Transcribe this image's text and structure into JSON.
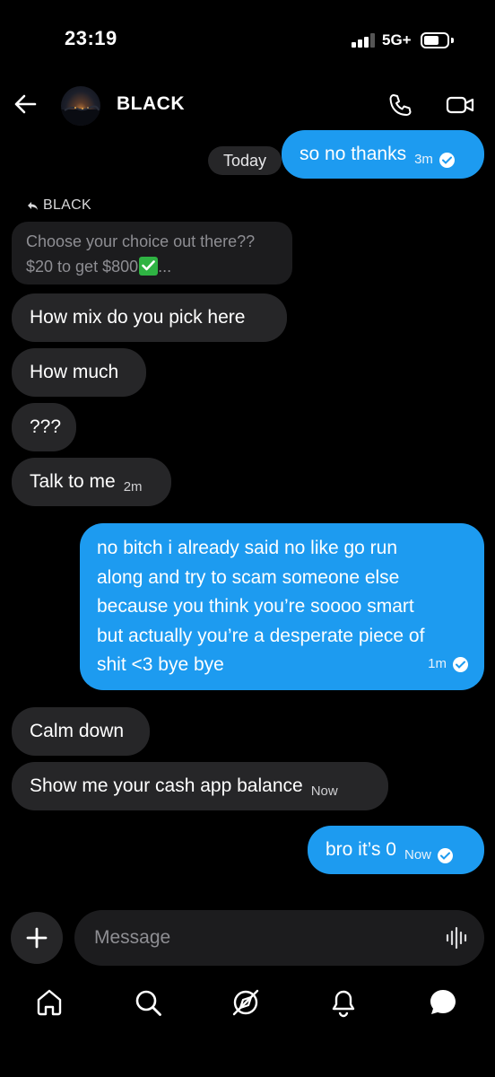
{
  "status_bar": {
    "time": "23:19",
    "network": "5G+",
    "battery_level": 0.65
  },
  "header": {
    "contact_name": "BLACK",
    "back_icon": "arrow-left-icon",
    "call_icon": "phone-icon",
    "video_icon": "video-camera-icon"
  },
  "thread": {
    "date_label": "Today",
    "messages": [
      {
        "from": "me",
        "text": "so no thanks",
        "time": "3m",
        "read": true
      },
      {
        "from": "them",
        "reply_to_name": "BLACK",
        "quoted_line_1": "Choose your choice out there??",
        "quoted_line_2": "$20 to get $800",
        "quoted_suffix": "..."
      },
      {
        "from": "them",
        "text": "How mix do you pick here"
      },
      {
        "from": "them",
        "text": "How much"
      },
      {
        "from": "them",
        "text": "???"
      },
      {
        "from": "them",
        "text": "Talk to me",
        "time": "2m"
      },
      {
        "from": "me",
        "lines": [
          "no bitch i already said no like go run",
          "along and try to scam someone else",
          "because you think you’re soooo smart",
          "but actually you’re a desperate piece of",
          "shit <3 bye bye"
        ],
        "time": "1m",
        "read": true
      },
      {
        "from": "them",
        "text": "Calm down"
      },
      {
        "from": "them",
        "text": "Show me your cash app balance",
        "time": "Now"
      },
      {
        "from": "me",
        "text": "bro it’s 0",
        "time": "Now",
        "read": true
      }
    ]
  },
  "composer": {
    "placeholder": "Message",
    "plus_icon": "plus-icon",
    "voice_icon": "voice-waveform-icon"
  },
  "tab_bar": {
    "items": [
      "home-icon",
      "search-icon",
      "compass-icon",
      "bell-icon",
      "chat-bubble-icon"
    ]
  },
  "colors": {
    "background": "#000000",
    "outgoing_bubble": "#1d9bf0",
    "incoming_bubble": "#262628"
  }
}
